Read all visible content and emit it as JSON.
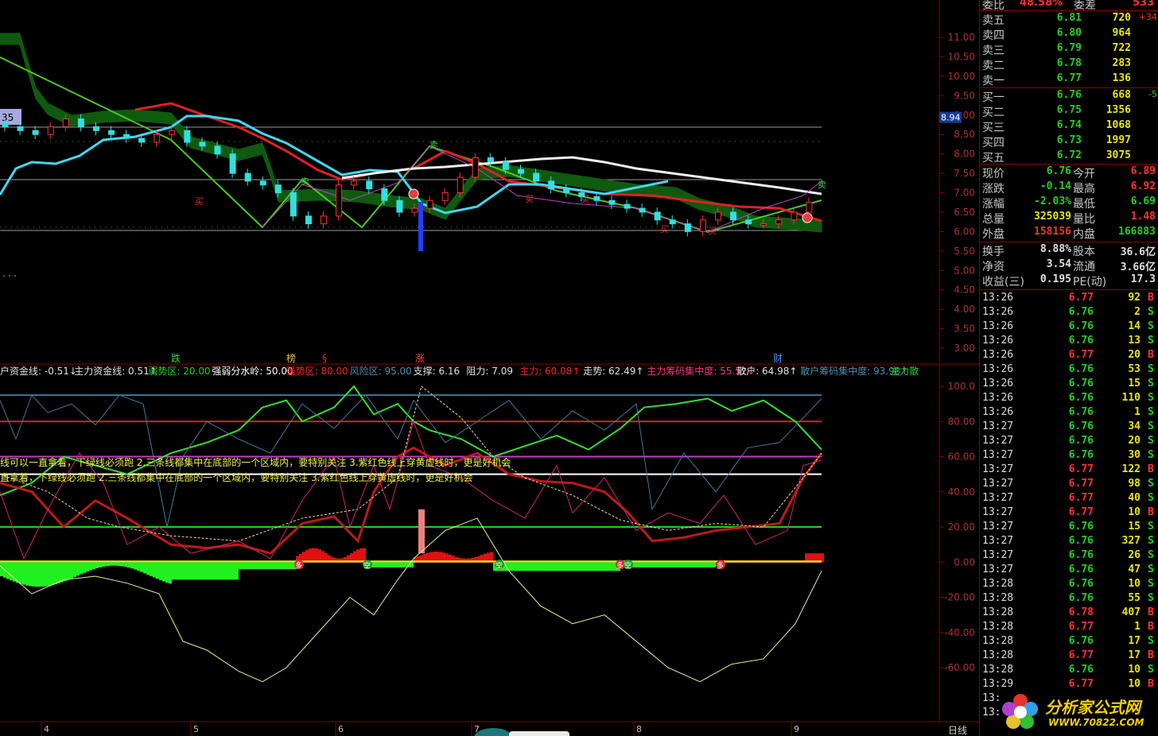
{
  "chart_data": [
    {
      "type": "line",
      "panel": "main price (candlestick)",
      "y_ticks": [
        "11.00",
        "10.50",
        "10.00",
        "9.50",
        "9.00",
        "8.50",
        "8.00",
        "7.50",
        "7.00",
        "6.50",
        "6.00",
        "5.50",
        "5.00",
        "4.50",
        "4.00",
        "3.50",
        "3.00"
      ],
      "y_range": [
        3.0,
        11.0
      ],
      "price_tag": "8.94",
      "left_tag": "35",
      "markers": [
        "跌",
        "榜",
        "§",
        "涨",
        "财"
      ],
      "buy_sell_labels": [
        "卖",
        "买"
      ],
      "close": [
        8.7,
        8.6,
        8.5,
        8.7,
        8.9,
        8.7,
        8.6,
        8.5,
        8.4,
        8.3,
        8.5,
        8.6,
        8.3,
        8.2,
        8.0,
        7.5,
        7.3,
        7.2,
        7.0,
        6.4,
        6.2,
        6.4,
        7.2,
        7.3,
        7.1,
        6.8,
        6.5,
        6.6,
        6.8,
        7.0,
        7.4,
        7.9,
        7.8,
        7.6,
        7.5,
        7.3,
        7.1,
        7.0,
        6.9,
        6.8,
        6.7,
        6.6,
        6.5,
        6.3,
        6.2,
        6.0,
        6.3,
        6.5,
        6.3,
        6.2,
        6.2,
        6.3,
        6.5,
        6.76
      ]
    },
    {
      "type": "line",
      "panel": "indicator",
      "legend": [
        {
          "text": "户资金线: -0.51↓",
          "color": "#e0e0e0"
        },
        {
          "text": "主力资金线: 0.51↑",
          "color": "#e0e0e0"
        },
        {
          "text": "弱势区: 20.00",
          "color": "#20d020"
        },
        {
          "text": "强弱分水岭: 50.00",
          "color": "#ffffff"
        },
        {
          "text": "强势区: 80.00",
          "color": "#ff2020"
        },
        {
          "text": "风险区: 95.00",
          "color": "#4a90b0"
        },
        {
          "text": "支撑: 6.16",
          "color": "#e0e0e0"
        },
        {
          "text": "阻力: 7.09",
          "color": "#e0e0e0"
        },
        {
          "text": "主力: 60.08↑",
          "color": "#ff2020"
        },
        {
          "text": "走势: 62.49↑",
          "color": "#e0e0e0"
        },
        {
          "text": "主力筹码集中度: 55.52↓",
          "color": "#ff3080"
        },
        {
          "text": "散户: 64.98↑",
          "color": "#e0e0e0"
        },
        {
          "text": "散户筹码集中度: 93.98↑",
          "color": "#4a90b0"
        },
        {
          "text": "主力散",
          "color": "#20d020"
        }
      ],
      "y_ticks": [
        "100.0",
        "80.00",
        "60.00",
        "40.00",
        "20.00",
        "0.00",
        "-20.00",
        "-40.00",
        "-60.00"
      ],
      "y_range": [
        -60,
        100
      ],
      "notes": [
        "线可以一直拿着，下绿线必须跑 2.三条线都集中在底部的一个区域内，要特别关注 3.紫红色线上穿黄虚线时，更是好机会",
        "直拿着，下绿线必须跑 2.三条线都集中在底部的一个区域内，要特别关注 3.紫红色线上穿黄虚线时，更是好机会"
      ],
      "badges": [
        "多",
        "空"
      ]
    }
  ],
  "x_axis": {
    "labels": [
      "4",
      "5",
      "6",
      "7",
      "8",
      "9"
    ],
    "period": "日线"
  },
  "quote": {
    "header": {
      "label": "委比",
      "ratio": "48.58%",
      "label2": "委差",
      "diff": "533"
    },
    "sell": [
      {
        "label": "卖五",
        "price": "6.81",
        "vol": "720",
        "chg": "+34"
      },
      {
        "label": "卖四",
        "price": "6.80",
        "vol": "964",
        "chg": ""
      },
      {
        "label": "卖三",
        "price": "6.79",
        "vol": "722",
        "chg": ""
      },
      {
        "label": "卖二",
        "price": "6.78",
        "vol": "283",
        "chg": ""
      },
      {
        "label": "卖一",
        "price": "6.77",
        "vol": "136",
        "chg": ""
      }
    ],
    "buy": [
      {
        "label": "买一",
        "price": "6.76",
        "vol": "668",
        "chg": "-5"
      },
      {
        "label": "买二",
        "price": "6.75",
        "vol": "1356",
        "chg": ""
      },
      {
        "label": "买三",
        "price": "6.74",
        "vol": "1068",
        "chg": ""
      },
      {
        "label": "买四",
        "price": "6.73",
        "vol": "1997",
        "chg": ""
      },
      {
        "label": "买五",
        "price": "6.72",
        "vol": "3075",
        "chg": ""
      }
    ],
    "stats": [
      {
        "l1": "现价",
        "v1": "6.76",
        "c1": "#20d020",
        "l2": "今开",
        "v2": "6.89",
        "c2": "#ff3030"
      },
      {
        "l1": "涨跌",
        "v1": "-0.14",
        "c1": "#20d020",
        "l2": "最高",
        "v2": "6.92",
        "c2": "#ff3030"
      },
      {
        "l1": "涨幅",
        "v1": "-2.03%",
        "c1": "#20d020",
        "l2": "最低",
        "v2": "6.69",
        "c2": "#20d020"
      },
      {
        "l1": "总量",
        "v1": "325039",
        "c1": "#e8e800",
        "l2": "量比",
        "v2": "1.48",
        "c2": "#ff3030"
      },
      {
        "l1": "外盘",
        "v1": "158156",
        "c1": "#ff3030",
        "l2": "内盘",
        "v2": "166883",
        "c2": "#20d020"
      }
    ],
    "stats2": [
      {
        "l1": "换手",
        "v1": "8.88%",
        "c1": "#e0e0e0",
        "l2": "股本",
        "v2": "36.6亿",
        "c2": "#e0e0e0"
      },
      {
        "l1": "净资",
        "v1": "3.54",
        "c1": "#e0e0e0",
        "l2": "流通",
        "v2": "3.66亿",
        "c2": "#e0e0e0"
      },
      {
        "l1": "收益(三)",
        "v1": "0.195",
        "c1": "#e0e0e0",
        "l2": "PE(动)",
        "v2": "17.3",
        "c2": "#e0e0e0"
      }
    ],
    "ticks": [
      [
        "13:26",
        "6.77",
        "92",
        "B"
      ],
      [
        "13:26",
        "6.76",
        "2",
        "S"
      ],
      [
        "13:26",
        "6.76",
        "14",
        "S"
      ],
      [
        "13:26",
        "6.76",
        "13",
        "S"
      ],
      [
        "13:26",
        "6.77",
        "20",
        "B"
      ],
      [
        "13:26",
        "6.76",
        "53",
        "S"
      ],
      [
        "13:26",
        "6.76",
        "15",
        "S"
      ],
      [
        "13:26",
        "6.76",
        "110",
        "S"
      ],
      [
        "13:26",
        "6.76",
        "1",
        "S"
      ],
      [
        "13:27",
        "6.76",
        "34",
        "S"
      ],
      [
        "13:27",
        "6.76",
        "20",
        "S"
      ],
      [
        "13:27",
        "6.76",
        "30",
        "S"
      ],
      [
        "13:27",
        "6.77",
        "122",
        "B"
      ],
      [
        "13:27",
        "6.77",
        "98",
        "S"
      ],
      [
        "13:27",
        "6.77",
        "40",
        "S"
      ],
      [
        "13:27",
        "6.77",
        "10",
        "B"
      ],
      [
        "13:27",
        "6.76",
        "15",
        "S"
      ],
      [
        "13:27",
        "6.76",
        "327",
        "S"
      ],
      [
        "13:27",
        "6.76",
        "26",
        "S"
      ],
      [
        "13:27",
        "6.76",
        "47",
        "S"
      ],
      [
        "13:28",
        "6.76",
        "10",
        "S"
      ],
      [
        "13:28",
        "6.76",
        "55",
        "S"
      ],
      [
        "13:28",
        "6.78",
        "407",
        "B"
      ],
      [
        "13:28",
        "6.77",
        "1",
        "B"
      ],
      [
        "13:28",
        "6.76",
        "17",
        "S"
      ],
      [
        "13:28",
        "6.77",
        "17",
        "B"
      ],
      [
        "13:28",
        "6.76",
        "10",
        "S"
      ],
      [
        "13:29",
        "6.77",
        "10",
        "B"
      ],
      [
        "13:",
        "",
        ""
      ],
      [
        "13:",
        "",
        ""
      ]
    ]
  },
  "watermark": {
    "title": "分析家公式网",
    "url": "WWW.70822.COM"
  }
}
